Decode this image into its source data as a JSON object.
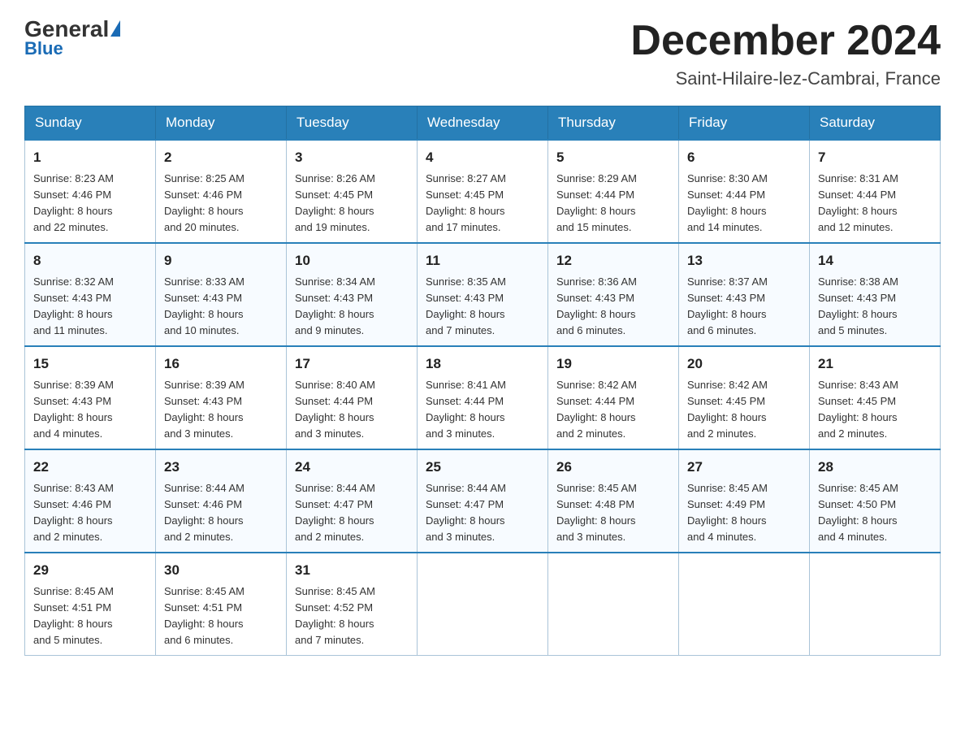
{
  "header": {
    "logo_general": "General",
    "logo_blue": "Blue",
    "month_title": "December 2024",
    "location": "Saint-Hilaire-lez-Cambrai, France"
  },
  "days_of_week": [
    "Sunday",
    "Monday",
    "Tuesday",
    "Wednesday",
    "Thursday",
    "Friday",
    "Saturday"
  ],
  "weeks": [
    [
      {
        "day": "1",
        "sunrise": "8:23 AM",
        "sunset": "4:46 PM",
        "daylight": "8 hours and 22 minutes."
      },
      {
        "day": "2",
        "sunrise": "8:25 AM",
        "sunset": "4:46 PM",
        "daylight": "8 hours and 20 minutes."
      },
      {
        "day": "3",
        "sunrise": "8:26 AM",
        "sunset": "4:45 PM",
        "daylight": "8 hours and 19 minutes."
      },
      {
        "day": "4",
        "sunrise": "8:27 AM",
        "sunset": "4:45 PM",
        "daylight": "8 hours and 17 minutes."
      },
      {
        "day": "5",
        "sunrise": "8:29 AM",
        "sunset": "4:44 PM",
        "daylight": "8 hours and 15 minutes."
      },
      {
        "day": "6",
        "sunrise": "8:30 AM",
        "sunset": "4:44 PM",
        "daylight": "8 hours and 14 minutes."
      },
      {
        "day": "7",
        "sunrise": "8:31 AM",
        "sunset": "4:44 PM",
        "daylight": "8 hours and 12 minutes."
      }
    ],
    [
      {
        "day": "8",
        "sunrise": "8:32 AM",
        "sunset": "4:43 PM",
        "daylight": "8 hours and 11 minutes."
      },
      {
        "day": "9",
        "sunrise": "8:33 AM",
        "sunset": "4:43 PM",
        "daylight": "8 hours and 10 minutes."
      },
      {
        "day": "10",
        "sunrise": "8:34 AM",
        "sunset": "4:43 PM",
        "daylight": "8 hours and 9 minutes."
      },
      {
        "day": "11",
        "sunrise": "8:35 AM",
        "sunset": "4:43 PM",
        "daylight": "8 hours and 7 minutes."
      },
      {
        "day": "12",
        "sunrise": "8:36 AM",
        "sunset": "4:43 PM",
        "daylight": "8 hours and 6 minutes."
      },
      {
        "day": "13",
        "sunrise": "8:37 AM",
        "sunset": "4:43 PM",
        "daylight": "8 hours and 6 minutes."
      },
      {
        "day": "14",
        "sunrise": "8:38 AM",
        "sunset": "4:43 PM",
        "daylight": "8 hours and 5 minutes."
      }
    ],
    [
      {
        "day": "15",
        "sunrise": "8:39 AM",
        "sunset": "4:43 PM",
        "daylight": "8 hours and 4 minutes."
      },
      {
        "day": "16",
        "sunrise": "8:39 AM",
        "sunset": "4:43 PM",
        "daylight": "8 hours and 3 minutes."
      },
      {
        "day": "17",
        "sunrise": "8:40 AM",
        "sunset": "4:44 PM",
        "daylight": "8 hours and 3 minutes."
      },
      {
        "day": "18",
        "sunrise": "8:41 AM",
        "sunset": "4:44 PM",
        "daylight": "8 hours and 3 minutes."
      },
      {
        "day": "19",
        "sunrise": "8:42 AM",
        "sunset": "4:44 PM",
        "daylight": "8 hours and 2 minutes."
      },
      {
        "day": "20",
        "sunrise": "8:42 AM",
        "sunset": "4:45 PM",
        "daylight": "8 hours and 2 minutes."
      },
      {
        "day": "21",
        "sunrise": "8:43 AM",
        "sunset": "4:45 PM",
        "daylight": "8 hours and 2 minutes."
      }
    ],
    [
      {
        "day": "22",
        "sunrise": "8:43 AM",
        "sunset": "4:46 PM",
        "daylight": "8 hours and 2 minutes."
      },
      {
        "day": "23",
        "sunrise": "8:44 AM",
        "sunset": "4:46 PM",
        "daylight": "8 hours and 2 minutes."
      },
      {
        "day": "24",
        "sunrise": "8:44 AM",
        "sunset": "4:47 PM",
        "daylight": "8 hours and 2 minutes."
      },
      {
        "day": "25",
        "sunrise": "8:44 AM",
        "sunset": "4:47 PM",
        "daylight": "8 hours and 3 minutes."
      },
      {
        "day": "26",
        "sunrise": "8:45 AM",
        "sunset": "4:48 PM",
        "daylight": "8 hours and 3 minutes."
      },
      {
        "day": "27",
        "sunrise": "8:45 AM",
        "sunset": "4:49 PM",
        "daylight": "8 hours and 4 minutes."
      },
      {
        "day": "28",
        "sunrise": "8:45 AM",
        "sunset": "4:50 PM",
        "daylight": "8 hours and 4 minutes."
      }
    ],
    [
      {
        "day": "29",
        "sunrise": "8:45 AM",
        "sunset": "4:51 PM",
        "daylight": "8 hours and 5 minutes."
      },
      {
        "day": "30",
        "sunrise": "8:45 AM",
        "sunset": "4:51 PM",
        "daylight": "8 hours and 6 minutes."
      },
      {
        "day": "31",
        "sunrise": "8:45 AM",
        "sunset": "4:52 PM",
        "daylight": "8 hours and 7 minutes."
      },
      null,
      null,
      null,
      null
    ]
  ],
  "labels": {
    "sunrise": "Sunrise:",
    "sunset": "Sunset:",
    "daylight": "Daylight:"
  }
}
